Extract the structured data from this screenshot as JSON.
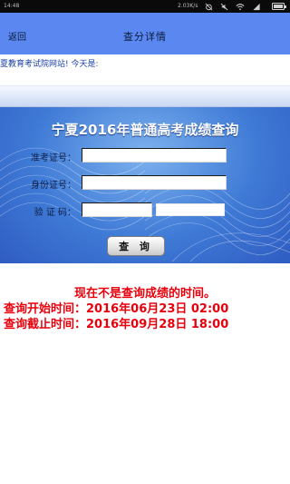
{
  "status_bar": {
    "time": "14:48",
    "net_speed": "2.03K/s",
    "icons": [
      "alarm-off-icon",
      "mute-icon",
      "wifi-icon",
      "signal-icon",
      "battery-icon"
    ],
    "battery_level": 0.8
  },
  "title_bar": {
    "back_label": "返回",
    "title": "查分详情",
    "background": "#5b88f0"
  },
  "marquee": {
    "text": "夏教育考试院网站!   今天是:"
  },
  "query_panel": {
    "title": "宁夏2016年普通高考成绩查询",
    "exam_id_label": "准考证号：",
    "exam_id_value": "",
    "id_card_label": "身份证号：",
    "id_card_value": "",
    "captcha_label": "验 证 码：",
    "captcha_value": "",
    "submit_label": "查 询"
  },
  "notice": {
    "line1": "现在不是查询成绩的时间。",
    "line2": "查询开始时间：2016年06月23日 02:00",
    "line3": "查询截止时间：2016年09月28日 18:00",
    "color": "#e8000c"
  }
}
